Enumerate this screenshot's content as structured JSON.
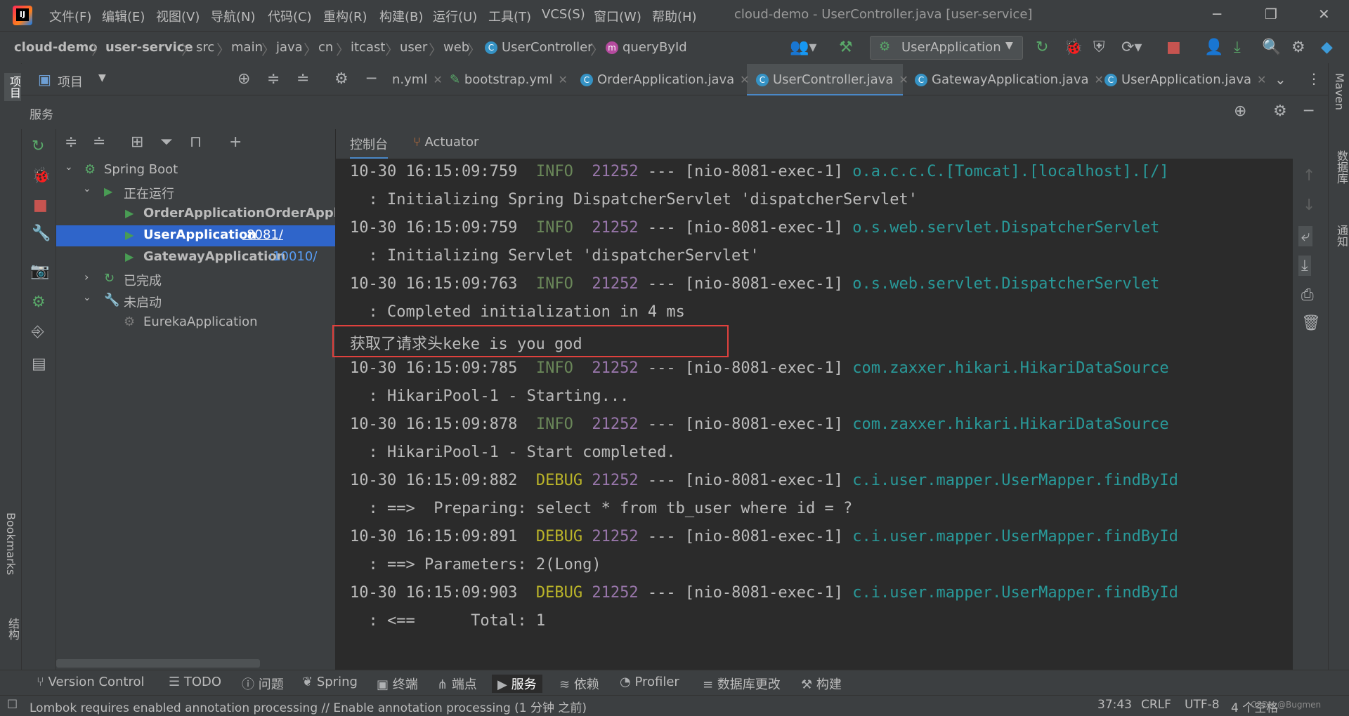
{
  "window": {
    "title": "cloud-demo - UserController.java [user-service]",
    "logo_text": "IJ",
    "menu": [
      "文件(F)",
      "编辑(E)",
      "视图(V)",
      "导航(N)",
      "代码(C)",
      "重构(R)",
      "构建(B)",
      "运行(U)",
      "工具(T)",
      "VCS(S)",
      "窗口(W)",
      "帮助(H)"
    ],
    "controls": {
      "minimize": "─",
      "restore": "❐",
      "close": "✕"
    }
  },
  "breadcrumb": [
    "cloud-demo",
    "user-service",
    "src",
    "main",
    "java",
    "cn",
    "itcast",
    "user",
    "web",
    "UserController",
    "queryById"
  ],
  "toolbar": {
    "run_config": "UserApplication"
  },
  "project_panel": {
    "label": "项目"
  },
  "editor_tabs": [
    {
      "label": "n.yml",
      "active": false
    },
    {
      "label": "bootstrap.yml",
      "active": false
    },
    {
      "label": "OrderApplication.java",
      "active": false
    },
    {
      "label": "UserController.java",
      "active": true
    },
    {
      "label": "GatewayApplication.java",
      "active": false
    },
    {
      "label": "UserApplication.java",
      "active": false
    }
  ],
  "left_bar": {
    "project": "项目",
    "bookmarks": "Bookmarks",
    "structure": "结构"
  },
  "right_bar": {
    "maven": "Maven",
    "database": "数据库",
    "notifications": "通知"
  },
  "services": {
    "title": "服务",
    "tree": {
      "spring_boot": "Spring Boot",
      "running": "正在运行",
      "order_app": "OrderApplicationOrderApplicati",
      "user_app": "UserApplication",
      "user_port": ":8081/",
      "gateway_app": "GatewayApplication",
      "gateway_port": ":10010/",
      "finished": "已完成",
      "not_started": "未启动",
      "eureka_app": "EurekaApplication"
    },
    "console_tabs": {
      "console": "控制台",
      "actuator": "Actuator"
    }
  },
  "console_lines": [
    {
      "kind": "log",
      "ts": "10-30 16:15:09:759",
      "level": "INFO",
      "pid": "21252",
      "thread": " --- [nio-8081-exec-1] ",
      "logger": "o.a.c.c.C.[Tomcat].[localhost].[/]"
    },
    {
      "kind": "msg",
      "text": "  : Initializing Spring DispatcherServlet 'dispatcherServlet'"
    },
    {
      "kind": "log",
      "ts": "10-30 16:15:09:759",
      "level": "INFO",
      "pid": "21252",
      "thread": " --- [nio-8081-exec-1] ",
      "logger": "o.s.web.servlet.DispatcherServlet"
    },
    {
      "kind": "msg",
      "text": "  : Initializing Servlet 'dispatcherServlet'"
    },
    {
      "kind": "log",
      "ts": "10-30 16:15:09:763",
      "level": "INFO",
      "pid": "21252",
      "thread": " --- [nio-8081-exec-1] ",
      "logger": "o.s.web.servlet.DispatcherServlet"
    },
    {
      "kind": "msg",
      "text": "  : Completed initialization in 4 ms"
    },
    {
      "kind": "plain",
      "text": "获取了请求头keke is you god"
    },
    {
      "kind": "log",
      "ts": "10-30 16:15:09:785",
      "level": "INFO",
      "pid": "21252",
      "thread": " --- [nio-8081-exec-1] ",
      "logger": "com.zaxxer.hikari.HikariDataSource"
    },
    {
      "kind": "msg",
      "text": "  : HikariPool-1 - Starting..."
    },
    {
      "kind": "log",
      "ts": "10-30 16:15:09:878",
      "level": "INFO",
      "pid": "21252",
      "thread": " --- [nio-8081-exec-1] ",
      "logger": "com.zaxxer.hikari.HikariDataSource"
    },
    {
      "kind": "msg",
      "text": "  : HikariPool-1 - Start completed."
    },
    {
      "kind": "log",
      "ts": "10-30 16:15:09:882",
      "level": "DEBUG",
      "pid": "21252",
      "thread": " --- [nio-8081-exec-1] ",
      "logger": "c.i.user.mapper.UserMapper.findById"
    },
    {
      "kind": "msg",
      "text": "  : ==>  Preparing: select * from tb_user where id = ?"
    },
    {
      "kind": "log",
      "ts": "10-30 16:15:09:891",
      "level": "DEBUG",
      "pid": "21252",
      "thread": " --- [nio-8081-exec-1] ",
      "logger": "c.i.user.mapper.UserMapper.findById"
    },
    {
      "kind": "msg",
      "text": "  : ==> Parameters: 2(Long)"
    },
    {
      "kind": "log",
      "ts": "10-30 16:15:09:903",
      "level": "DEBUG",
      "pid": "21252",
      "thread": " --- [nio-8081-exec-1] ",
      "logger": "c.i.user.mapper.UserMapper.findById"
    },
    {
      "kind": "msg",
      "text": "  : <==      Total: 1"
    }
  ],
  "bottom_tools": [
    "Version Control",
    "TODO",
    "问题",
    "Spring",
    "终端",
    "端点",
    "服务",
    "依赖",
    "Profiler",
    "数据库更改",
    "构建"
  ],
  "status": {
    "message": "Lombok requires enabled annotation processing // Enable annotation processing (1 分钟 之前)",
    "position": "37:43",
    "line_sep": "CRLF",
    "encoding": "UTF-8",
    "indent": "4 个空格"
  },
  "watermark": "CSDN @Bugmen"
}
